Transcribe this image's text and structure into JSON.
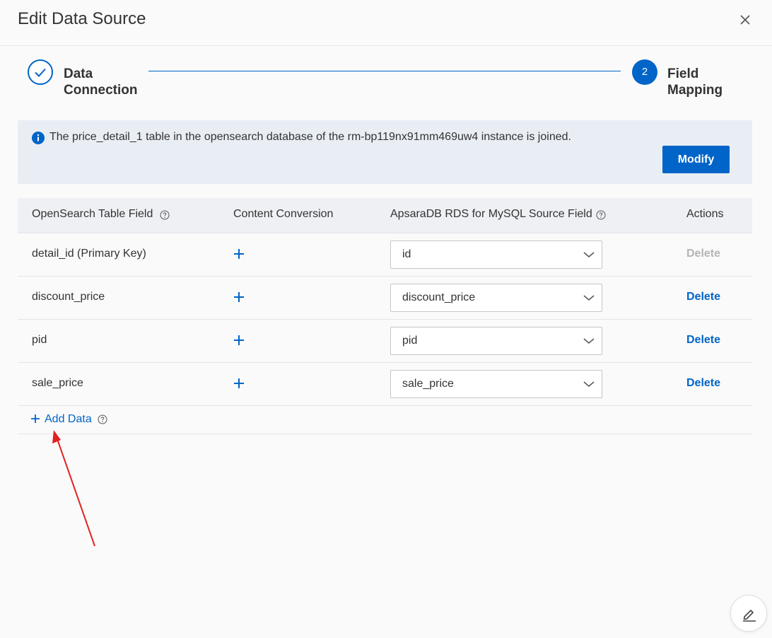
{
  "dialog": {
    "title": "Edit Data Source",
    "close_icon": "close-icon"
  },
  "steps": [
    {
      "label": "Data Connection",
      "status": "done",
      "icon": "check-icon"
    },
    {
      "label": "Field Mapping",
      "number": "2",
      "status": "active"
    }
  ],
  "notice": {
    "icon": "info-icon",
    "text": "The price_detail_1 table in the opensearch database of the rm-bp119nx91mm469uw4 instance is joined.",
    "modify_label": "Modify"
  },
  "table": {
    "headers": {
      "field": "OpenSearch Table Field",
      "conversion": "Content Conversion",
      "source": "ApsaraDB RDS for MySQL Source Field",
      "actions": "Actions"
    },
    "rows": [
      {
        "field": "detail_id (Primary Key)",
        "source": "id",
        "action": "Delete",
        "action_enabled": false
      },
      {
        "field": "discount_price",
        "source": "discount_price",
        "action": "Delete",
        "action_enabled": true
      },
      {
        "field": "pid",
        "source": "pid",
        "action": "Delete",
        "action_enabled": true
      },
      {
        "field": "sale_price",
        "source": "sale_price",
        "action": "Delete",
        "action_enabled": true
      }
    ],
    "add_label": "Add Data"
  },
  "colors": {
    "primary": "#0064c8",
    "annotation_arrow": "#e02020",
    "disabled": "#b5b5b5"
  },
  "fab": {
    "icon": "edit-icon"
  }
}
